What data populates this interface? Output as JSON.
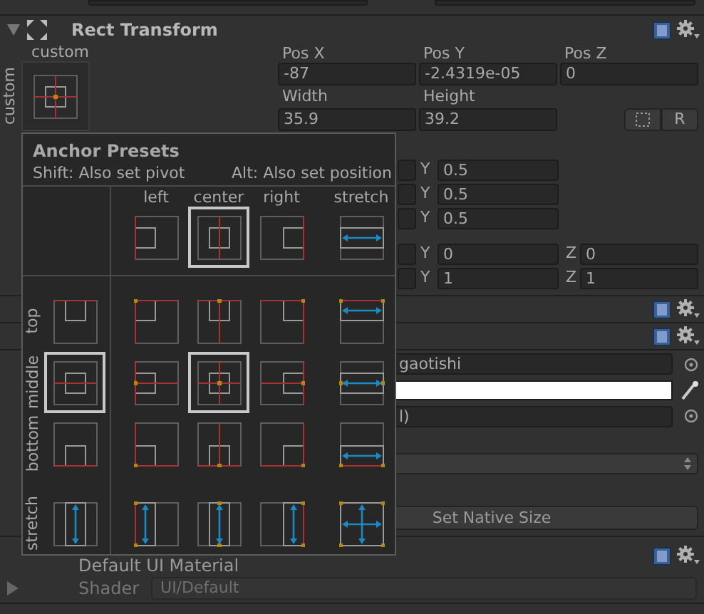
{
  "component": {
    "title": "Rect Transform",
    "expanded": true
  },
  "anchor_widget": {
    "top_label": "custom",
    "side_label": "custom"
  },
  "position": [
    {
      "label": "Pos X",
      "value": "-87"
    },
    {
      "label": "Pos Y",
      "value": "-2.4319e-05"
    },
    {
      "label": "Pos Z",
      "value": "0"
    }
  ],
  "size": [
    {
      "label": "Width",
      "value": "35.9"
    },
    {
      "label": "Height",
      "value": "39.2"
    }
  ],
  "raw_edit_button": "R",
  "anchor_rows": [
    {
      "label": "Y",
      "value": "0.5"
    },
    {
      "label": "Y",
      "value": "0.5"
    },
    {
      "label": "Y",
      "value": "0.5"
    }
  ],
  "rotation_scale_rows": [
    {
      "y_label": "Y",
      "y_value": "0",
      "z_label": "Z",
      "z_value": "0"
    },
    {
      "y_label": "Y",
      "y_value": "1",
      "z_label": "Z",
      "z_value": "1"
    }
  ],
  "image": {
    "sprite": "gaotishi",
    "color": "#ffffff",
    "material": "l)"
  },
  "set_native_size": "Set Native Size",
  "material": {
    "title": "Default UI Material",
    "expanded": false,
    "shader_label": "Shader",
    "shader": "UI/Default"
  },
  "anchor_presets": {
    "title": "Anchor Presets",
    "hint_shift": "Shift: Also set pivot",
    "hint_alt": "Alt: Also set position",
    "columns": [
      {
        "label": "left",
        "selected": false
      },
      {
        "label": "center",
        "selected": true
      },
      {
        "label": "right",
        "selected": false
      },
      {
        "label": "stretch",
        "selected": false
      }
    ],
    "rows": [
      {
        "label": "top",
        "cells": [
          {
            "selected": false
          },
          {
            "selected": false
          },
          {
            "selected": false
          },
          {
            "selected": false
          },
          {
            "selected": false
          }
        ]
      },
      {
        "label": "middle",
        "cells": [
          {
            "selected": true
          },
          {
            "selected": false
          },
          {
            "selected": true
          },
          {
            "selected": false
          },
          {
            "selected": false
          }
        ]
      },
      {
        "label": "bottom",
        "cells": [
          {
            "selected": false
          },
          {
            "selected": false
          },
          {
            "selected": false
          },
          {
            "selected": false
          },
          {
            "selected": false
          }
        ]
      },
      {
        "label": "stretch",
        "cells": [
          {
            "selected": false
          },
          {
            "selected": false
          },
          {
            "selected": false
          },
          {
            "selected": false
          },
          {
            "selected": false
          }
        ]
      }
    ]
  }
}
